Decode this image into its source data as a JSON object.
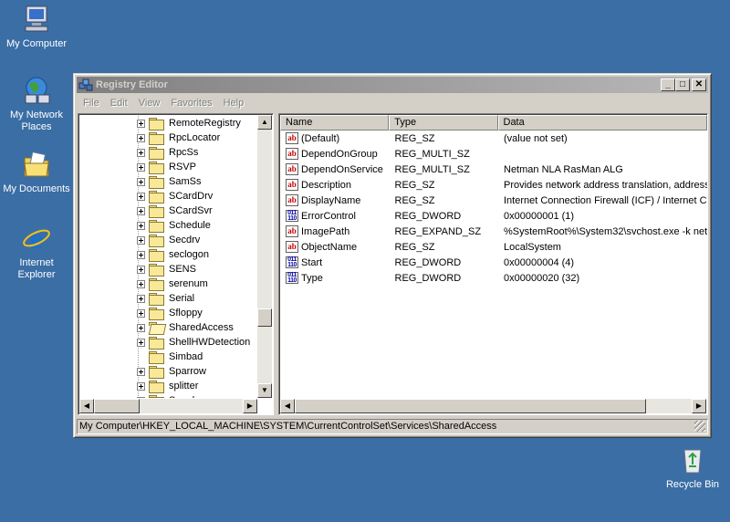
{
  "desktop": {
    "icons": [
      {
        "label": "My Computer",
        "icon": "computer-icon"
      },
      {
        "label": "My Network Places",
        "icon": "network-places-icon"
      },
      {
        "label": "My Documents",
        "icon": "documents-folder-icon"
      },
      {
        "label": "Internet Explorer",
        "icon": "internet-explorer-icon"
      },
      {
        "label": "Recycle Bin",
        "icon": "recycle-bin-icon"
      }
    ]
  },
  "window": {
    "title": "Registry Editor",
    "controls": {
      "minimize": "_",
      "maximize": "□",
      "close": "✕"
    },
    "menu": [
      "File",
      "Edit",
      "View",
      "Favorites",
      "Help"
    ],
    "tree": [
      {
        "label": "RemoteRegistry",
        "expandable": true
      },
      {
        "label": "RpcLocator",
        "expandable": true
      },
      {
        "label": "RpcSs",
        "expandable": true
      },
      {
        "label": "RSVP",
        "expandable": true
      },
      {
        "label": "SamSs",
        "expandable": true
      },
      {
        "label": "SCardDrv",
        "expandable": true
      },
      {
        "label": "SCardSvr",
        "expandable": true
      },
      {
        "label": "Schedule",
        "expandable": true
      },
      {
        "label": "Secdrv",
        "expandable": true
      },
      {
        "label": "seclogon",
        "expandable": true
      },
      {
        "label": "SENS",
        "expandable": true
      },
      {
        "label": "serenum",
        "expandable": true
      },
      {
        "label": "Serial",
        "expandable": true
      },
      {
        "label": "Sfloppy",
        "expandable": true
      },
      {
        "label": "SharedAccess",
        "expandable": true,
        "open": true
      },
      {
        "label": "ShellHWDetection",
        "expandable": true
      },
      {
        "label": "Simbad",
        "expandable": false
      },
      {
        "label": "Sparrow",
        "expandable": true
      },
      {
        "label": "splitter",
        "expandable": true
      },
      {
        "label": "Spooler",
        "expandable": true
      }
    ],
    "columns": {
      "name": "Name",
      "type": "Type",
      "data": "Data"
    },
    "values": [
      {
        "icon": "ab",
        "name": "(Default)",
        "type": "REG_SZ",
        "data": "(value not set)"
      },
      {
        "icon": "ab",
        "name": "DependOnGroup",
        "type": "REG_MULTI_SZ",
        "data": ""
      },
      {
        "icon": "ab",
        "name": "DependOnService",
        "type": "REG_MULTI_SZ",
        "data": "Netman NLA RasMan ALG"
      },
      {
        "icon": "ab",
        "name": "Description",
        "type": "REG_SZ",
        "data": "Provides network address translation, address"
      },
      {
        "icon": "ab",
        "name": "DisplayName",
        "type": "REG_SZ",
        "data": "Internet Connection Firewall (ICF) / Internet C"
      },
      {
        "icon": "bin",
        "name": "ErrorControl",
        "type": "REG_DWORD",
        "data": "0x00000001 (1)"
      },
      {
        "icon": "ab",
        "name": "ImagePath",
        "type": "REG_EXPAND_SZ",
        "data": "%SystemRoot%\\System32\\svchost.exe -k net"
      },
      {
        "icon": "ab",
        "name": "ObjectName",
        "type": "REG_SZ",
        "data": "LocalSystem"
      },
      {
        "icon": "bin",
        "name": "Start",
        "type": "REG_DWORD",
        "data": "0x00000004 (4)"
      },
      {
        "icon": "bin",
        "name": "Type",
        "type": "REG_DWORD",
        "data": "0x00000020 (32)"
      }
    ],
    "status": "My Computer\\HKEY_LOCAL_MACHINE\\SYSTEM\\CurrentControlSet\\Services\\SharedAccess"
  },
  "colors": {
    "desktop": "#3a6ea5",
    "window": "#d4d0c8",
    "inactive_title": "#808080"
  }
}
